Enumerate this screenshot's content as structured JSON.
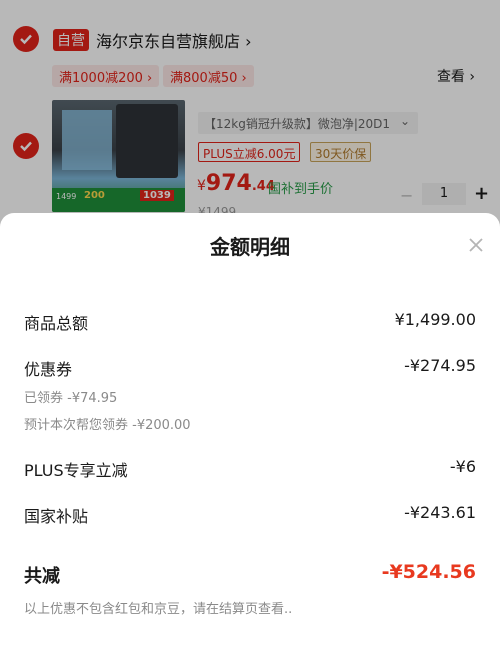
{
  "cart": {
    "store_tag": "自营",
    "store_name": "海尔京东自营旗舰店",
    "store_chevron": "›",
    "coupons": [
      "满1000减200 ›",
      "满800减50 ›"
    ],
    "view_more": "查看 ›",
    "product": {
      "image_texts": {
        "left": "1499",
        "mid": "200",
        "right": "1039"
      },
      "spec": "【12kg销冠升级款】微泡净|20D1",
      "spec_caret": "⌄",
      "plus_tag": "PLUS立减6.00元",
      "price_tag": "30天价保",
      "price_currency": "¥",
      "price_int": "974",
      "price_dec": ".44",
      "subsidy_text": "国补到手价",
      "original_price": "¥1499",
      "quantity": "1",
      "minus_symbol": "−",
      "plus_symbol": "+"
    }
  },
  "sheet": {
    "title": "金额明细",
    "rows": [
      {
        "label": "商品总额",
        "value": "¥1,499.00"
      },
      {
        "label": "优惠券",
        "value": "-¥274.95"
      },
      {
        "label": "PLUS专享立减",
        "value": "-¥6"
      },
      {
        "label": "国家补贴",
        "value": "-¥243.61"
      }
    ],
    "coupon_details": [
      "已领券 -¥74.95",
      "预计本次帮您领券 -¥200.00"
    ],
    "total_label": "共减",
    "total_value": "-¥524.56",
    "footnote": "以上优惠不包含红包和京豆，请在结算页查看.."
  },
  "colors": {
    "accent": "#e2231a",
    "total": "#e8391f",
    "subsidy": "#2a9d4a"
  }
}
